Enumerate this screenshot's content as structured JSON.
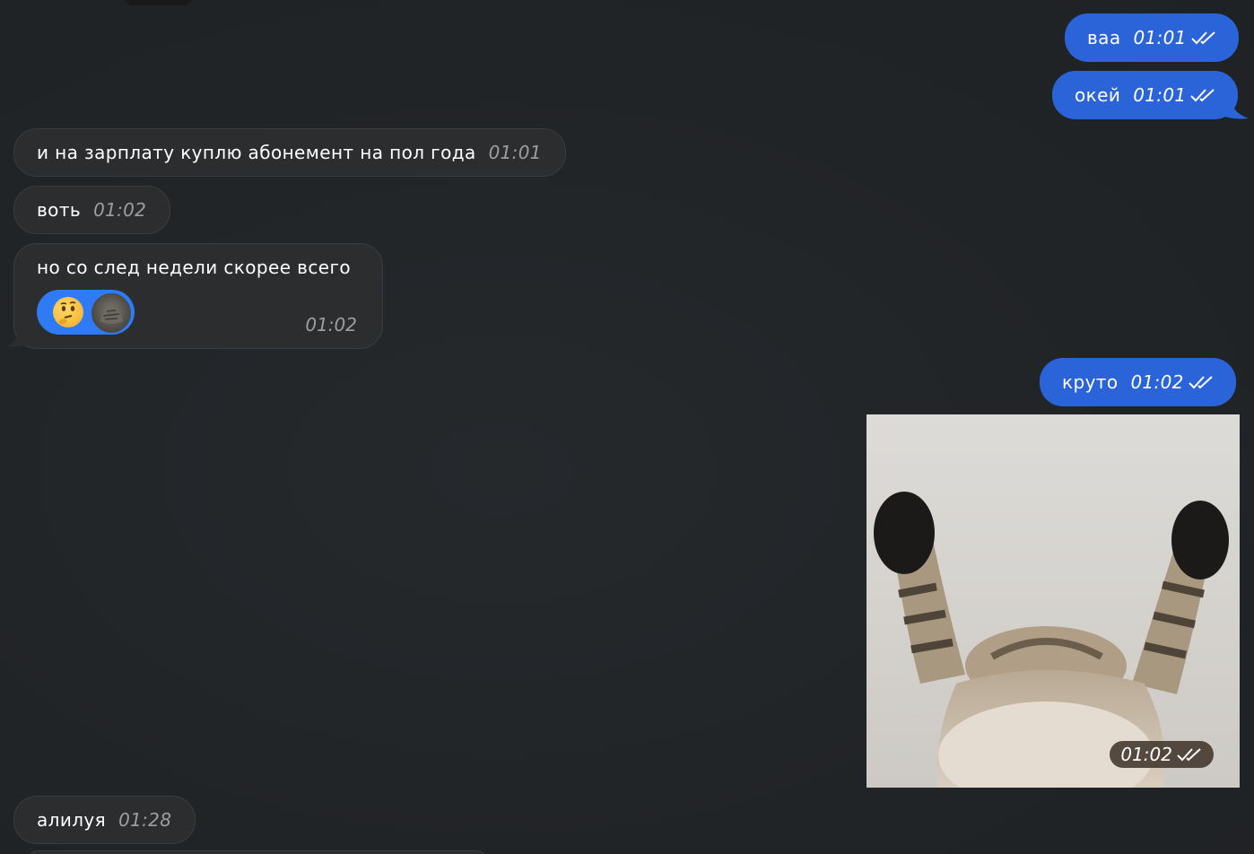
{
  "messages": [
    {
      "id": "m1",
      "direction": "outgoing",
      "text": "ваа",
      "time": "01:01",
      "status": "read"
    },
    {
      "id": "m2",
      "direction": "outgoing",
      "text": "окей",
      "time": "01:01",
      "status": "read"
    },
    {
      "id": "m3",
      "direction": "incoming",
      "text": "и на зарплату куплю абонемент на пол года",
      "time": "01:01"
    },
    {
      "id": "m4",
      "direction": "incoming",
      "text": "воть",
      "time": "01:02"
    },
    {
      "id": "m5",
      "direction": "incoming",
      "text": "но со след недели скорее всего",
      "time": "01:02",
      "reaction": {
        "emoji_name": "thinking-face-icon",
        "reactor": "avatar"
      }
    },
    {
      "id": "m6",
      "direction": "outgoing",
      "text": "круто",
      "time": "01:02",
      "status": "read"
    },
    {
      "id": "m7",
      "direction": "outgoing",
      "type": "video-sticker",
      "subject": "cat-raising-paws",
      "time": "01:02",
      "status": "read"
    },
    {
      "id": "m8",
      "direction": "incoming",
      "text": "алилуя",
      "time": "01:28"
    }
  ],
  "colors": {
    "background": "#212427",
    "incoming_bubble": "#2b2d2f",
    "outgoing_bubble": "#2a64d8",
    "reaction_pill": "#2f7bf5",
    "incoming_time": "#9c9ea2"
  }
}
